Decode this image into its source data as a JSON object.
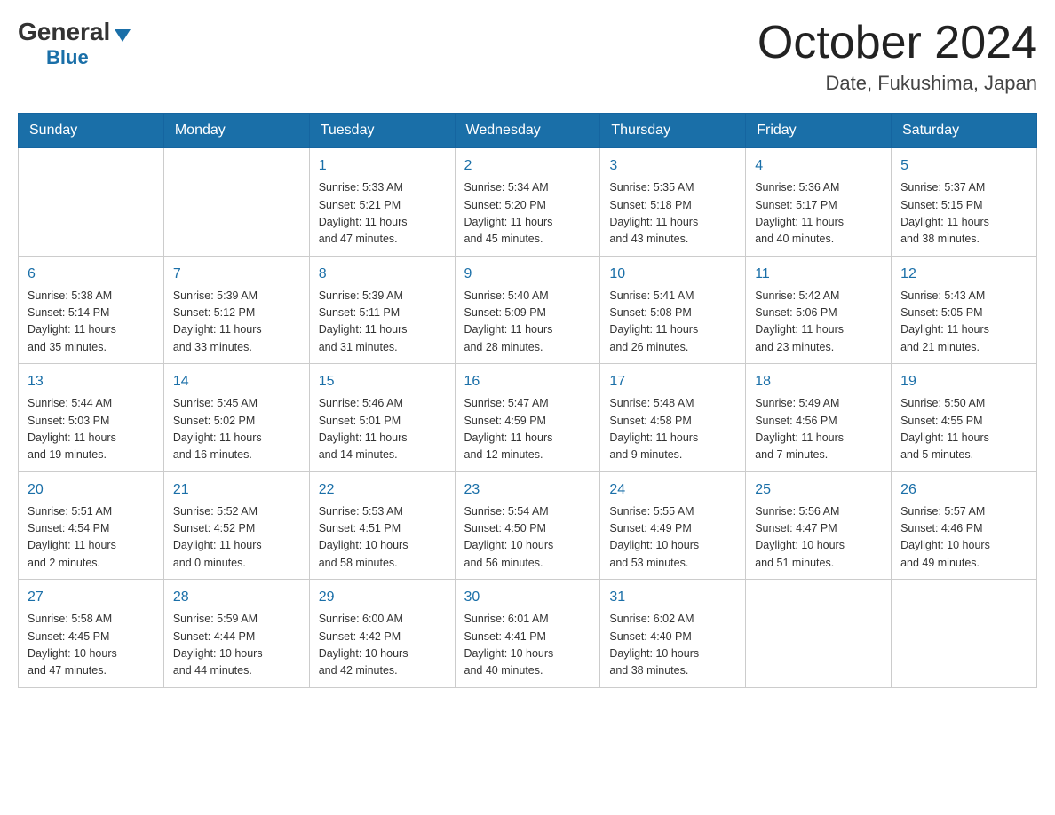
{
  "header": {
    "logo_general": "General",
    "logo_blue": "Blue",
    "month": "October 2024",
    "location": "Date, Fukushima, Japan"
  },
  "weekdays": [
    "Sunday",
    "Monday",
    "Tuesday",
    "Wednesday",
    "Thursday",
    "Friday",
    "Saturday"
  ],
  "weeks": [
    [
      {
        "day": "",
        "info": ""
      },
      {
        "day": "",
        "info": ""
      },
      {
        "day": "1",
        "info": "Sunrise: 5:33 AM\nSunset: 5:21 PM\nDaylight: 11 hours\nand 47 minutes."
      },
      {
        "day": "2",
        "info": "Sunrise: 5:34 AM\nSunset: 5:20 PM\nDaylight: 11 hours\nand 45 minutes."
      },
      {
        "day": "3",
        "info": "Sunrise: 5:35 AM\nSunset: 5:18 PM\nDaylight: 11 hours\nand 43 minutes."
      },
      {
        "day": "4",
        "info": "Sunrise: 5:36 AM\nSunset: 5:17 PM\nDaylight: 11 hours\nand 40 minutes."
      },
      {
        "day": "5",
        "info": "Sunrise: 5:37 AM\nSunset: 5:15 PM\nDaylight: 11 hours\nand 38 minutes."
      }
    ],
    [
      {
        "day": "6",
        "info": "Sunrise: 5:38 AM\nSunset: 5:14 PM\nDaylight: 11 hours\nand 35 minutes."
      },
      {
        "day": "7",
        "info": "Sunrise: 5:39 AM\nSunset: 5:12 PM\nDaylight: 11 hours\nand 33 minutes."
      },
      {
        "day": "8",
        "info": "Sunrise: 5:39 AM\nSunset: 5:11 PM\nDaylight: 11 hours\nand 31 minutes."
      },
      {
        "day": "9",
        "info": "Sunrise: 5:40 AM\nSunset: 5:09 PM\nDaylight: 11 hours\nand 28 minutes."
      },
      {
        "day": "10",
        "info": "Sunrise: 5:41 AM\nSunset: 5:08 PM\nDaylight: 11 hours\nand 26 minutes."
      },
      {
        "day": "11",
        "info": "Sunrise: 5:42 AM\nSunset: 5:06 PM\nDaylight: 11 hours\nand 23 minutes."
      },
      {
        "day": "12",
        "info": "Sunrise: 5:43 AM\nSunset: 5:05 PM\nDaylight: 11 hours\nand 21 minutes."
      }
    ],
    [
      {
        "day": "13",
        "info": "Sunrise: 5:44 AM\nSunset: 5:03 PM\nDaylight: 11 hours\nand 19 minutes."
      },
      {
        "day": "14",
        "info": "Sunrise: 5:45 AM\nSunset: 5:02 PM\nDaylight: 11 hours\nand 16 minutes."
      },
      {
        "day": "15",
        "info": "Sunrise: 5:46 AM\nSunset: 5:01 PM\nDaylight: 11 hours\nand 14 minutes."
      },
      {
        "day": "16",
        "info": "Sunrise: 5:47 AM\nSunset: 4:59 PM\nDaylight: 11 hours\nand 12 minutes."
      },
      {
        "day": "17",
        "info": "Sunrise: 5:48 AM\nSunset: 4:58 PM\nDaylight: 11 hours\nand 9 minutes."
      },
      {
        "day": "18",
        "info": "Sunrise: 5:49 AM\nSunset: 4:56 PM\nDaylight: 11 hours\nand 7 minutes."
      },
      {
        "day": "19",
        "info": "Sunrise: 5:50 AM\nSunset: 4:55 PM\nDaylight: 11 hours\nand 5 minutes."
      }
    ],
    [
      {
        "day": "20",
        "info": "Sunrise: 5:51 AM\nSunset: 4:54 PM\nDaylight: 11 hours\nand 2 minutes."
      },
      {
        "day": "21",
        "info": "Sunrise: 5:52 AM\nSunset: 4:52 PM\nDaylight: 11 hours\nand 0 minutes."
      },
      {
        "day": "22",
        "info": "Sunrise: 5:53 AM\nSunset: 4:51 PM\nDaylight: 10 hours\nand 58 minutes."
      },
      {
        "day": "23",
        "info": "Sunrise: 5:54 AM\nSunset: 4:50 PM\nDaylight: 10 hours\nand 56 minutes."
      },
      {
        "day": "24",
        "info": "Sunrise: 5:55 AM\nSunset: 4:49 PM\nDaylight: 10 hours\nand 53 minutes."
      },
      {
        "day": "25",
        "info": "Sunrise: 5:56 AM\nSunset: 4:47 PM\nDaylight: 10 hours\nand 51 minutes."
      },
      {
        "day": "26",
        "info": "Sunrise: 5:57 AM\nSunset: 4:46 PM\nDaylight: 10 hours\nand 49 minutes."
      }
    ],
    [
      {
        "day": "27",
        "info": "Sunrise: 5:58 AM\nSunset: 4:45 PM\nDaylight: 10 hours\nand 47 minutes."
      },
      {
        "day": "28",
        "info": "Sunrise: 5:59 AM\nSunset: 4:44 PM\nDaylight: 10 hours\nand 44 minutes."
      },
      {
        "day": "29",
        "info": "Sunrise: 6:00 AM\nSunset: 4:42 PM\nDaylight: 10 hours\nand 42 minutes."
      },
      {
        "day": "30",
        "info": "Sunrise: 6:01 AM\nSunset: 4:41 PM\nDaylight: 10 hours\nand 40 minutes."
      },
      {
        "day": "31",
        "info": "Sunrise: 6:02 AM\nSunset: 4:40 PM\nDaylight: 10 hours\nand 38 minutes."
      },
      {
        "day": "",
        "info": ""
      },
      {
        "day": "",
        "info": ""
      }
    ]
  ]
}
